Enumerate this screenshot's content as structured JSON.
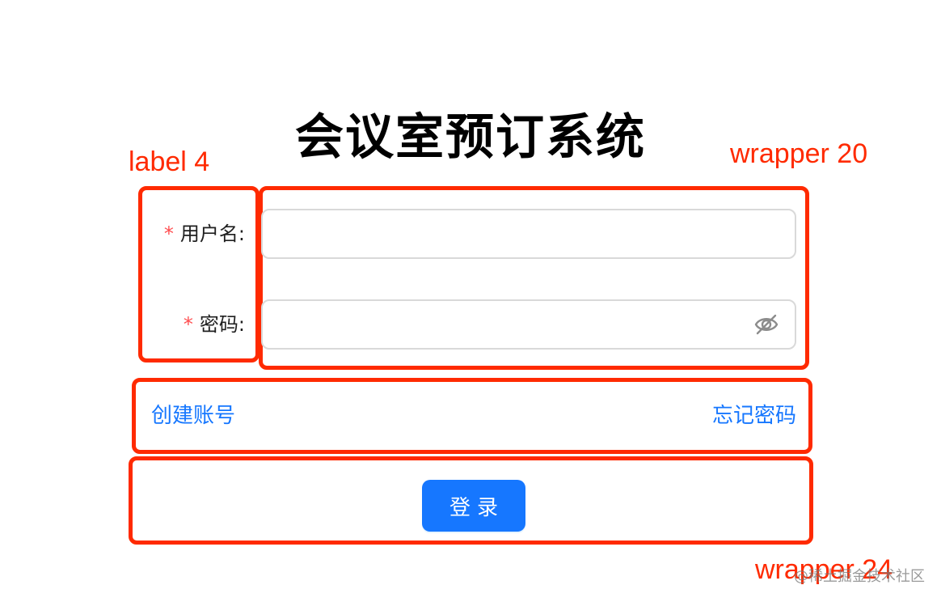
{
  "page": {
    "title": "会议室预订系统"
  },
  "annotations": {
    "label_tag": "label 4",
    "wrapper_20_tag": "wrapper 20",
    "wrapper_24_tag": "wrapper 24",
    "color": "#ff2a00"
  },
  "form": {
    "required_mark": "*",
    "username": {
      "label": "用户名:",
      "value": "",
      "placeholder": ""
    },
    "password": {
      "label": "密码:",
      "value": "",
      "placeholder": "",
      "toggle_icon": "eye-slash-icon"
    }
  },
  "links": {
    "create_account": "创建账号",
    "forgot_password": "忘记密码"
  },
  "actions": {
    "login_label": "登录"
  },
  "watermark": "@稀土掘金技术社区",
  "colors": {
    "primary": "#1677ff",
    "required": "#ff4d4f",
    "border": "#d9d9d9"
  }
}
